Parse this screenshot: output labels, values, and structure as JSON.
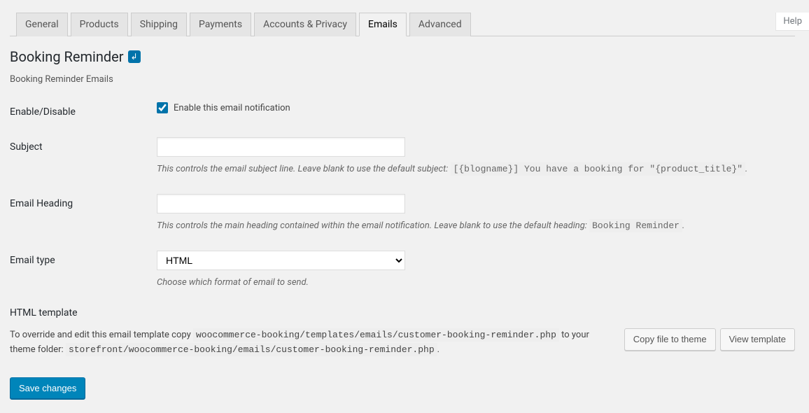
{
  "help_tab": "Help",
  "tabs": [
    {
      "label": "General",
      "active": false
    },
    {
      "label": "Products",
      "active": false
    },
    {
      "label": "Shipping",
      "active": false
    },
    {
      "label": "Payments",
      "active": false
    },
    {
      "label": "Accounts & Privacy",
      "active": false
    },
    {
      "label": "Emails",
      "active": true
    },
    {
      "label": "Advanced",
      "active": false
    }
  ],
  "page_title": "Booking Reminder",
  "subtitle": "Booking Reminder Emails",
  "fields": {
    "enable": {
      "label": "Enable/Disable",
      "checkbox_label": "Enable this email notification",
      "checked": true
    },
    "subject": {
      "label": "Subject",
      "value": "",
      "description_pre": "This controls the email subject line. Leave blank to use the default subject: ",
      "description_code": "[{blogname}] You have a booking for \"{product_title}\"",
      "description_post": "."
    },
    "heading": {
      "label": "Email Heading",
      "value": "",
      "description_pre": "This controls the main heading contained within the email notification. Leave blank to use the default heading: ",
      "description_code": "Booking Reminder",
      "description_post": "."
    },
    "email_type": {
      "label": "Email type",
      "value": "HTML",
      "description": "Choose which format of email to send."
    }
  },
  "template": {
    "heading": "HTML template",
    "text_pre": "To override and edit this email template copy ",
    "code1": "woocommerce-booking/templates/emails/customer-booking-reminder.php",
    "text_mid": " to your theme folder: ",
    "code2": "storefront/woocommerce-booking/emails/customer-booking-reminder.php",
    "text_post": ".",
    "button_copy": "Copy file to theme",
    "button_view": "View template"
  },
  "save_button": "Save changes"
}
